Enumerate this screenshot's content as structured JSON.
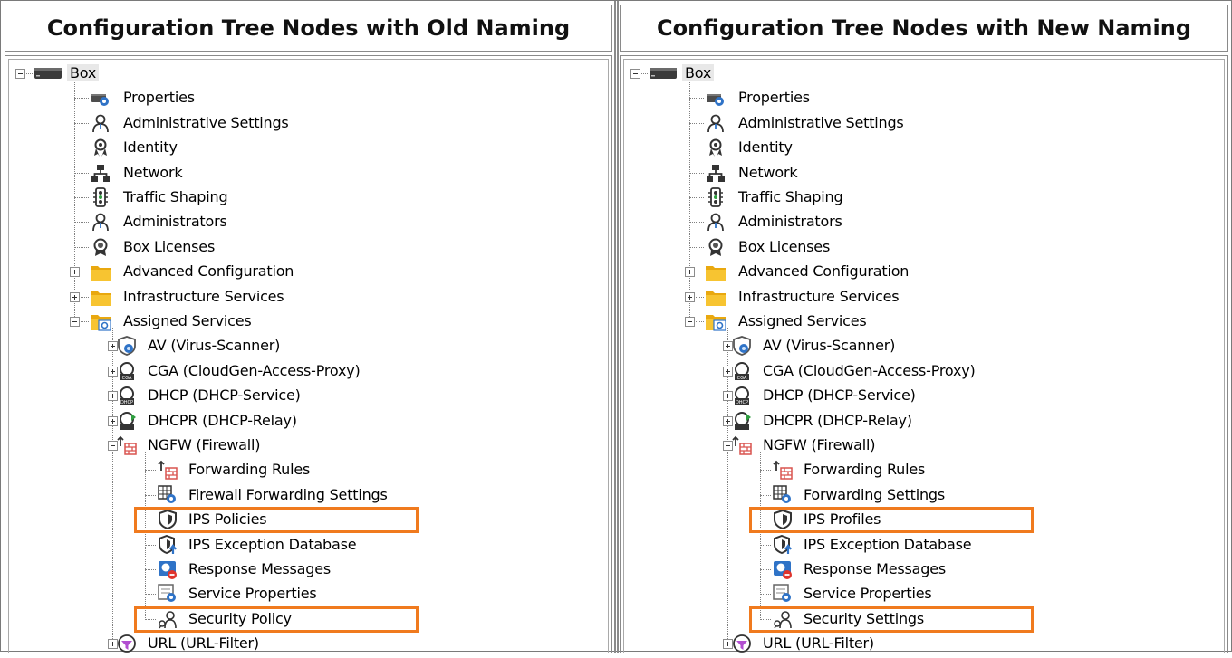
{
  "colors": {
    "highlight": "#f07a1e",
    "folder": "#f5b921"
  },
  "panels": [
    {
      "title": "Configuration Tree Nodes with Old Naming",
      "labels": {
        "box": "Box",
        "properties": "Properties",
        "admin_settings": "Administrative Settings",
        "identity": "Identity",
        "network": "Network",
        "traffic_shaping": "Traffic Shaping",
        "administrators": "Administrators",
        "box_licenses": "Box Licenses",
        "advanced_configuration": "Advanced Configuration",
        "infrastructure_services": "Infrastructure Services",
        "assigned_services": "Assigned Services",
        "av": "AV (Virus-Scanner)",
        "cga": "CGA (CloudGen-Access-Proxy)",
        "dhcp": "DHCP (DHCP-Service)",
        "dhcpr": "DHCPR (DHCP-Relay)",
        "ngfw": "NGFW (Firewall)",
        "forwarding_rules": "Forwarding Rules",
        "forwarding_settings": "Firewall Forwarding Settings",
        "ips": "IPS Policies",
        "ips_exception": "IPS Exception Database",
        "response_messages": "Response Messages",
        "service_properties": "Service Properties",
        "security": "Security Policy",
        "url": "URL (URL-Filter)"
      }
    },
    {
      "title": "Configuration Tree Nodes with New Naming",
      "labels": {
        "box": "Box",
        "properties": "Properties",
        "admin_settings": "Administrative Settings",
        "identity": "Identity",
        "network": "Network",
        "traffic_shaping": "Traffic Shaping",
        "administrators": "Administrators",
        "box_licenses": "Box Licenses",
        "advanced_configuration": "Advanced Configuration",
        "infrastructure_services": "Infrastructure Services",
        "assigned_services": "Assigned Services",
        "av": "AV (Virus-Scanner)",
        "cga": "CGA (CloudGen-Access-Proxy)",
        "dhcp": "DHCP (DHCP-Service)",
        "dhcpr": "DHCPR (DHCP-Relay)",
        "ngfw": "NGFW (Firewall)",
        "forwarding_rules": "Forwarding Rules",
        "forwarding_settings": "Forwarding Settings",
        "ips": "IPS Profiles",
        "ips_exception": "IPS Exception Database",
        "response_messages": "Response Messages",
        "service_properties": "Service Properties",
        "security": "Security Settings",
        "url": "URL (URL-Filter)"
      }
    }
  ],
  "icons": {
    "box": "server-icon",
    "properties": "properties-icon",
    "admin_settings": "user-icon",
    "identity": "certificate-icon",
    "network": "network-icon",
    "traffic_shaping": "traffic-light-icon",
    "administrators": "user-icon",
    "box_licenses": "license-icon",
    "advanced_configuration": "folder-icon",
    "infrastructure_services": "folder-icon",
    "assigned_services": "folder-gear-icon",
    "av": "shield-virus-icon",
    "cga": "cloud-access-icon",
    "dhcp": "dhcp-icon",
    "dhcpr": "dhcp-relay-icon",
    "ngfw": "firewall-icon",
    "forwarding_rules": "firewall-icon",
    "forwarding_settings": "grid-gear-icon",
    "ips": "shield-icon",
    "ips_exception": "shield-arrow-icon",
    "response_messages": "message-icon",
    "service_properties": "service-icon",
    "security": "security-user-icon",
    "url": "url-filter-icon"
  }
}
